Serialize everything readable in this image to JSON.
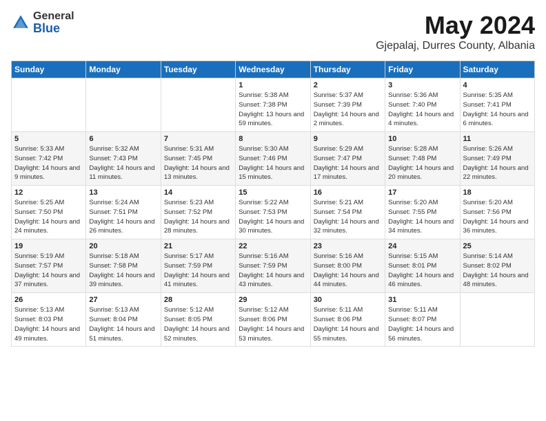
{
  "header": {
    "logo_general": "General",
    "logo_blue": "Blue",
    "month_title": "May 2024",
    "location": "Gjepalaj, Durres County, Albania"
  },
  "days_of_week": [
    "Sunday",
    "Monday",
    "Tuesday",
    "Wednesday",
    "Thursday",
    "Friday",
    "Saturday"
  ],
  "weeks": [
    [
      {
        "num": "",
        "sunrise": "",
        "sunset": "",
        "daylight": ""
      },
      {
        "num": "",
        "sunrise": "",
        "sunset": "",
        "daylight": ""
      },
      {
        "num": "",
        "sunrise": "",
        "sunset": "",
        "daylight": ""
      },
      {
        "num": "1",
        "sunrise": "Sunrise: 5:38 AM",
        "sunset": "Sunset: 7:38 PM",
        "daylight": "Daylight: 13 hours and 59 minutes."
      },
      {
        "num": "2",
        "sunrise": "Sunrise: 5:37 AM",
        "sunset": "Sunset: 7:39 PM",
        "daylight": "Daylight: 14 hours and 2 minutes."
      },
      {
        "num": "3",
        "sunrise": "Sunrise: 5:36 AM",
        "sunset": "Sunset: 7:40 PM",
        "daylight": "Daylight: 14 hours and 4 minutes."
      },
      {
        "num": "4",
        "sunrise": "Sunrise: 5:35 AM",
        "sunset": "Sunset: 7:41 PM",
        "daylight": "Daylight: 14 hours and 6 minutes."
      }
    ],
    [
      {
        "num": "5",
        "sunrise": "Sunrise: 5:33 AM",
        "sunset": "Sunset: 7:42 PM",
        "daylight": "Daylight: 14 hours and 9 minutes."
      },
      {
        "num": "6",
        "sunrise": "Sunrise: 5:32 AM",
        "sunset": "Sunset: 7:43 PM",
        "daylight": "Daylight: 14 hours and 11 minutes."
      },
      {
        "num": "7",
        "sunrise": "Sunrise: 5:31 AM",
        "sunset": "Sunset: 7:45 PM",
        "daylight": "Daylight: 14 hours and 13 minutes."
      },
      {
        "num": "8",
        "sunrise": "Sunrise: 5:30 AM",
        "sunset": "Sunset: 7:46 PM",
        "daylight": "Daylight: 14 hours and 15 minutes."
      },
      {
        "num": "9",
        "sunrise": "Sunrise: 5:29 AM",
        "sunset": "Sunset: 7:47 PM",
        "daylight": "Daylight: 14 hours and 17 minutes."
      },
      {
        "num": "10",
        "sunrise": "Sunrise: 5:28 AM",
        "sunset": "Sunset: 7:48 PM",
        "daylight": "Daylight: 14 hours and 20 minutes."
      },
      {
        "num": "11",
        "sunrise": "Sunrise: 5:26 AM",
        "sunset": "Sunset: 7:49 PM",
        "daylight": "Daylight: 14 hours and 22 minutes."
      }
    ],
    [
      {
        "num": "12",
        "sunrise": "Sunrise: 5:25 AM",
        "sunset": "Sunset: 7:50 PM",
        "daylight": "Daylight: 14 hours and 24 minutes."
      },
      {
        "num": "13",
        "sunrise": "Sunrise: 5:24 AM",
        "sunset": "Sunset: 7:51 PM",
        "daylight": "Daylight: 14 hours and 26 minutes."
      },
      {
        "num": "14",
        "sunrise": "Sunrise: 5:23 AM",
        "sunset": "Sunset: 7:52 PM",
        "daylight": "Daylight: 14 hours and 28 minutes."
      },
      {
        "num": "15",
        "sunrise": "Sunrise: 5:22 AM",
        "sunset": "Sunset: 7:53 PM",
        "daylight": "Daylight: 14 hours and 30 minutes."
      },
      {
        "num": "16",
        "sunrise": "Sunrise: 5:21 AM",
        "sunset": "Sunset: 7:54 PM",
        "daylight": "Daylight: 14 hours and 32 minutes."
      },
      {
        "num": "17",
        "sunrise": "Sunrise: 5:20 AM",
        "sunset": "Sunset: 7:55 PM",
        "daylight": "Daylight: 14 hours and 34 minutes."
      },
      {
        "num": "18",
        "sunrise": "Sunrise: 5:20 AM",
        "sunset": "Sunset: 7:56 PM",
        "daylight": "Daylight: 14 hours and 36 minutes."
      }
    ],
    [
      {
        "num": "19",
        "sunrise": "Sunrise: 5:19 AM",
        "sunset": "Sunset: 7:57 PM",
        "daylight": "Daylight: 14 hours and 37 minutes."
      },
      {
        "num": "20",
        "sunrise": "Sunrise: 5:18 AM",
        "sunset": "Sunset: 7:58 PM",
        "daylight": "Daylight: 14 hours and 39 minutes."
      },
      {
        "num": "21",
        "sunrise": "Sunrise: 5:17 AM",
        "sunset": "Sunset: 7:59 PM",
        "daylight": "Daylight: 14 hours and 41 minutes."
      },
      {
        "num": "22",
        "sunrise": "Sunrise: 5:16 AM",
        "sunset": "Sunset: 7:59 PM",
        "daylight": "Daylight: 14 hours and 43 minutes."
      },
      {
        "num": "23",
        "sunrise": "Sunrise: 5:16 AM",
        "sunset": "Sunset: 8:00 PM",
        "daylight": "Daylight: 14 hours and 44 minutes."
      },
      {
        "num": "24",
        "sunrise": "Sunrise: 5:15 AM",
        "sunset": "Sunset: 8:01 PM",
        "daylight": "Daylight: 14 hours and 46 minutes."
      },
      {
        "num": "25",
        "sunrise": "Sunrise: 5:14 AM",
        "sunset": "Sunset: 8:02 PM",
        "daylight": "Daylight: 14 hours and 48 minutes."
      }
    ],
    [
      {
        "num": "26",
        "sunrise": "Sunrise: 5:13 AM",
        "sunset": "Sunset: 8:03 PM",
        "daylight": "Daylight: 14 hours and 49 minutes."
      },
      {
        "num": "27",
        "sunrise": "Sunrise: 5:13 AM",
        "sunset": "Sunset: 8:04 PM",
        "daylight": "Daylight: 14 hours and 51 minutes."
      },
      {
        "num": "28",
        "sunrise": "Sunrise: 5:12 AM",
        "sunset": "Sunset: 8:05 PM",
        "daylight": "Daylight: 14 hours and 52 minutes."
      },
      {
        "num": "29",
        "sunrise": "Sunrise: 5:12 AM",
        "sunset": "Sunset: 8:06 PM",
        "daylight": "Daylight: 14 hours and 53 minutes."
      },
      {
        "num": "30",
        "sunrise": "Sunrise: 5:11 AM",
        "sunset": "Sunset: 8:06 PM",
        "daylight": "Daylight: 14 hours and 55 minutes."
      },
      {
        "num": "31",
        "sunrise": "Sunrise: 5:11 AM",
        "sunset": "Sunset: 8:07 PM",
        "daylight": "Daylight: 14 hours and 56 minutes."
      },
      {
        "num": "",
        "sunrise": "",
        "sunset": "",
        "daylight": ""
      }
    ]
  ]
}
